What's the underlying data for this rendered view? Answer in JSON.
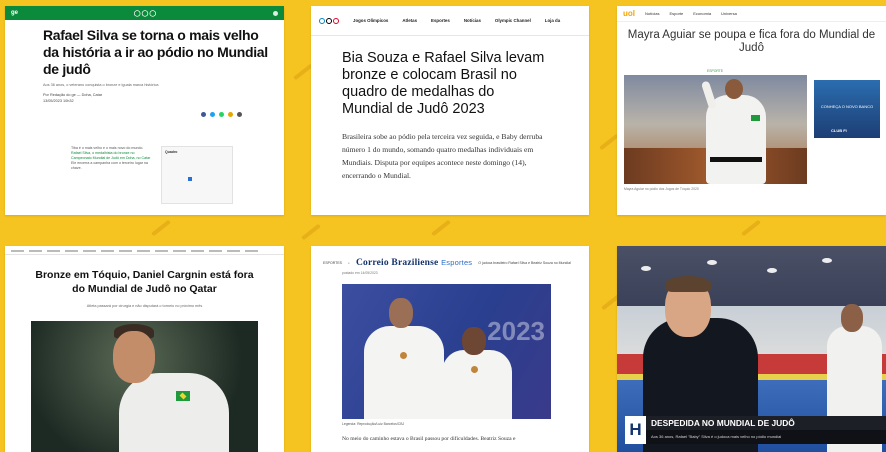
{
  "colors": {
    "background": "#f5c420",
    "ge_green": "#0a8a3a",
    "uol_orange": "#f5a300",
    "correio_blue": "#14346b",
    "brazil_green": "#1e9a3d"
  },
  "card1": {
    "brand": "ge",
    "headline": "Rafael Silva se torna o mais velho da história a ir ao pódio no Mundial de judô",
    "subheadline": "Aos 36 anos, o veterano conquista o bronze e iguala marca histórica",
    "byline": "Por Redação do ge — Doha, Catar",
    "dateline": "13/05/2023 10h32",
    "body_start": "Tiba é o mais velho e o mais novo do mundo.",
    "body_link": "Rafael Silva, o medalhista do bronze no Campeonato Mundial de Judô em Doha, no Catar",
    "body_end": "Ele encerra a campanha com o terceiro lugar na chave.",
    "embed_header": "Quadro"
  },
  "card2": {
    "nav": [
      "Jogos Olímpicos",
      "Atletas",
      "Esportes",
      "Notícias",
      "Olympic Channel",
      "Loja da"
    ],
    "headline": "Bia Souza e Rafael Silva levam bronze e colocam Brasil no quadro de medalhas do Mundial de Judô 2023",
    "lead": "Brasileira sobe ao pódio pela terceira vez seguida, e Baby derruba número 1 do mundo, somando quatro medalhas individuais em Mundiais. Disputa por equipes acontece neste domingo (14), encerrando o Mundial."
  },
  "card3": {
    "brand": "uol",
    "nav": [
      "Notícias",
      "Esporte",
      "Economia",
      "Universa"
    ],
    "headline": "Mayra Aguiar se poupa e fica fora do Mundial de Judô",
    "label": "ESPORTE",
    "caption": "Mayra Aguiar no pódio dos Jogos de Tóquio 2020",
    "ad_text": "CONHEÇA O NOVO BANCO",
    "ad_brand": "CLUB FI"
  },
  "card4": {
    "headline": "Bronze em Tóquio, Daniel Cargnin está fora do Mundial de Judô no Qatar",
    "subheadline": "Atleta passará por cirurgia e não disputará o torneio no próximo mês"
  },
  "card5": {
    "site_small": "ESPORTES",
    "brand": "Correio Braziliense",
    "brand_section": "Esportes",
    "top_note": "O judoca brasileiro Rafael Silva e Beatriz Souza no Mundial",
    "date": "postado em 14/05/2023",
    "photo_text": "2023",
    "credit": "Legenda: Reprodução/Luiz Barcelos/CBJ",
    "text": "No meio do caminho estava o Brasil passou por dificuldades. Beatriz Souza e"
  },
  "card6": {
    "logo_letter": "H",
    "lower_title": "DESPEDIDA NO MUNDIAL DE JUDÔ",
    "lower_sub": "Aos 36 anos, Rafael \"Baby\" Silva é o judoca mais velho no pódio mundial"
  }
}
